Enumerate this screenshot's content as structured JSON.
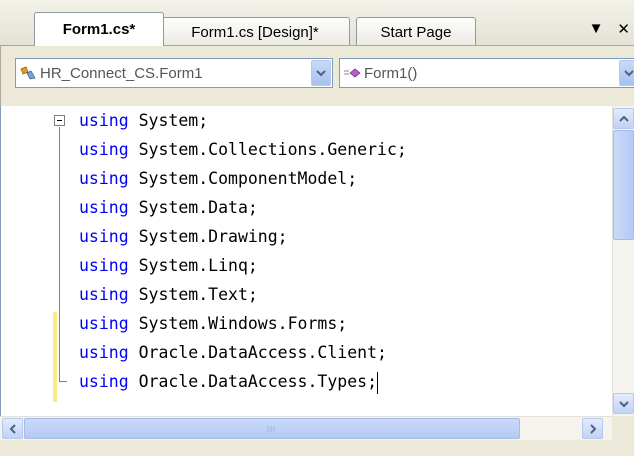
{
  "tabs": [
    {
      "label": "Form1.cs*",
      "active": true
    },
    {
      "label": "Form1.cs [Design]*",
      "active": false
    },
    {
      "label": "Start Page",
      "active": false
    }
  ],
  "tab_controls": {
    "dropdown_glyph": "▼",
    "close_glyph": "✕"
  },
  "nav": {
    "class_combo": {
      "value": "HR_Connect_CS.Form1",
      "icon": "class-icon"
    },
    "member_combo": {
      "value": "Form1()",
      "icon": "method-icon"
    }
  },
  "code": {
    "keyword": "using",
    "lines": [
      {
        "kw": "using",
        "rest": " System;"
      },
      {
        "kw": "using",
        "rest": " System.Collections.Generic;"
      },
      {
        "kw": "using",
        "rest": " System.ComponentModel;"
      },
      {
        "kw": "using",
        "rest": " System.Data;"
      },
      {
        "kw": "using",
        "rest": " System.Drawing;"
      },
      {
        "kw": "using",
        "rest": " System.Linq;"
      },
      {
        "kw": "using",
        "rest": " System.Text;"
      },
      {
        "kw": "using",
        "rest": " System.Windows.Forms;"
      },
      {
        "kw": "using",
        "rest": " Oracle.DataAccess.Client;"
      },
      {
        "kw": "using",
        "rest": " Oracle.DataAccess.Types;"
      }
    ]
  },
  "colors": {
    "keyword": "#0000ff",
    "change_marker": "#ffeb83"
  }
}
